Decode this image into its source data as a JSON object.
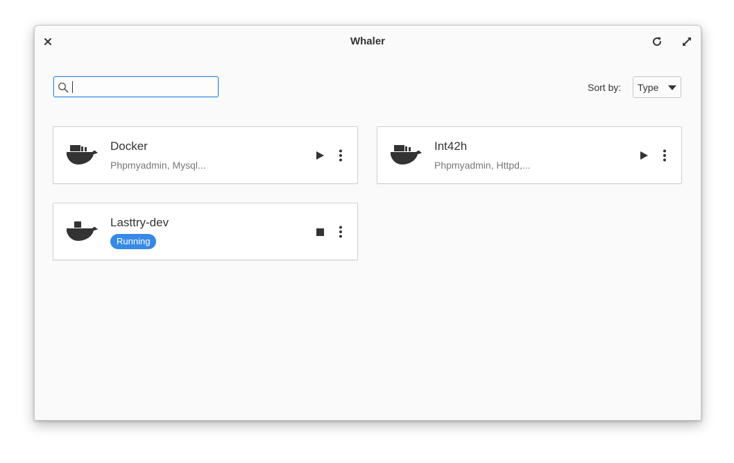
{
  "window": {
    "title": "Whaler"
  },
  "icons": {
    "close": "close-icon",
    "refresh": "refresh-icon",
    "maximize": "maximize-icon",
    "search": "search-icon",
    "whale": "docker-whale-icon",
    "play": "play-icon",
    "stop": "stop-icon",
    "more": "more-vertical-icon",
    "dropdown": "chevron-down-icon"
  },
  "search": {
    "value": "",
    "placeholder": ""
  },
  "sort": {
    "label": "Sort by:",
    "selected": "Type"
  },
  "containers": [
    {
      "name": "Docker",
      "subtitle": "Phpmyadmin, Mysql...",
      "state": "stopped"
    },
    {
      "name": "Int42h",
      "subtitle": "Phpmyadmin, Httpd,...",
      "state": "stopped"
    },
    {
      "name": "Lasttry-dev",
      "badge": "Running",
      "state": "running"
    }
  ],
  "colors": {
    "accent": "#3689e6",
    "icon": "#333333",
    "background": "#fafafa"
  }
}
